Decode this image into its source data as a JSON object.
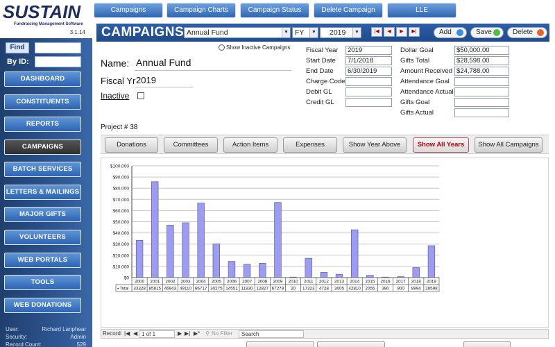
{
  "app": {
    "logo_text": "SUSTAIN",
    "logo_tagline": "Fundraising Management Software",
    "version": "3.1.14"
  },
  "sidebar": {
    "find_label": "Find",
    "by_id_label": "By ID:",
    "nav": [
      {
        "label": "DASHBOARD",
        "active": false
      },
      {
        "label": "CONSTITUENTS",
        "active": false
      },
      {
        "label": "REPORTS",
        "active": false
      },
      {
        "label": "CAMPAIGNS",
        "active": true
      },
      {
        "label": "BATCH SERVICES",
        "active": false
      },
      {
        "label": "LETTERS & MAILINGS",
        "active": false
      },
      {
        "label": "MAJOR GIFTS",
        "active": false
      },
      {
        "label": "VOLUNTEERS",
        "active": false
      },
      {
        "label": "WEB PORTALS",
        "active": false
      },
      {
        "label": "TOOLS",
        "active": false
      },
      {
        "label": "WEB DONATIONS",
        "active": false
      }
    ],
    "info": {
      "user_label": "User:",
      "user_value": "Richard Lanphear",
      "security_label": "Security:",
      "security_value": "Admin",
      "record_label": "Record Count:",
      "record_value": "529"
    }
  },
  "top_tabs": [
    "Campaigns",
    "Campaign Charts",
    "Campaign Status",
    "Delete Campaign",
    "LLE"
  ],
  "header": {
    "title": "CAMPAIGNS:",
    "campaign_select": "Annual Fund",
    "period_select": "FY",
    "year_select": "2019",
    "nav_icons": [
      "first-record-icon",
      "previous-record-icon",
      "next-record-icon",
      "last-record-icon"
    ],
    "add_label": "Add",
    "save_label": "Save",
    "delete_label": "Delete",
    "colors": {
      "add": "#3a8fe0",
      "save": "#4cc23a",
      "delete": "#e8632b"
    }
  },
  "campaign": {
    "name_label": "Name:",
    "name_value": "Annual Fund",
    "fiscal_label": "Fiscal Yr",
    "fiscal_value": "2019",
    "inactive_label": "Inactive",
    "show_inactive_label": "Show Inactive Campaigns",
    "project_label": "Project # 38"
  },
  "details_left": [
    {
      "label": "Fiscal Year",
      "value": "2019"
    },
    {
      "label": "Start Date",
      "value": "7/1/2018"
    },
    {
      "label": "End Date",
      "value": "6/30/2019"
    },
    {
      "label": "Charge Code",
      "value": ""
    },
    {
      "label": "Debit GL",
      "value": ""
    },
    {
      "label": "Credit GL",
      "value": ""
    }
  ],
  "details_right": [
    {
      "label": "Dollar Goal",
      "value": "$50,000.00"
    },
    {
      "label": "Gifts Total",
      "value": "$28,598.00"
    },
    {
      "label": "Amount Received",
      "value": "$24,788.00"
    },
    {
      "label": "Attendance Goal",
      "value": ""
    },
    {
      "label": "Attendance Actual",
      "value": ""
    },
    {
      "label": "Gifts Goal",
      "value": ""
    },
    {
      "label": "Gifts Actual",
      "value": ""
    }
  ],
  "sub_tabs": [
    {
      "label": "Donations",
      "hot": false
    },
    {
      "label": "Committees",
      "hot": false
    },
    {
      "label": "Action Items",
      "hot": false
    },
    {
      "label": "Expenses",
      "hot": false
    },
    {
      "label": "Show Year Above",
      "hot": false
    },
    {
      "label": "Show All Years",
      "hot": true
    },
    {
      "label": "Show All Campaigns",
      "hot": false
    }
  ],
  "chart_data": {
    "type": "bar",
    "categories": [
      "2000",
      "2001",
      "2002",
      "2003",
      "2004",
      "2005",
      "2006",
      "2007",
      "2008",
      "2009",
      "2010",
      "2011",
      "2012",
      "2013",
      "2014",
      "2015",
      "2016",
      "2017",
      "2018",
      "2019"
    ],
    "series": [
      {
        "name": "Total",
        "values": [
          33328,
          85815,
          46943,
          49110,
          66717,
          30275,
          14551,
          11930,
          12827,
          67279,
          20,
          17323,
          4728,
          3005,
          42810,
          2055,
          390,
          900,
          8994,
          28598
        ]
      }
    ],
    "y_ticks": [
      "$100,000",
      "$90,000",
      "$80,000",
      "$70,000",
      "$60,000",
      "$50,000",
      "$40,000",
      "$30,000",
      "$20,000",
      "$10,000",
      "$0"
    ],
    "ylim": [
      0,
      100000
    ],
    "grid": true,
    "bar_color": "#9c9cf0",
    "table_row_label": "Total"
  },
  "record_bar": {
    "record_label": "Record:",
    "position": "1 of 1",
    "filter_label": "No Filter",
    "search_label": "Search"
  }
}
